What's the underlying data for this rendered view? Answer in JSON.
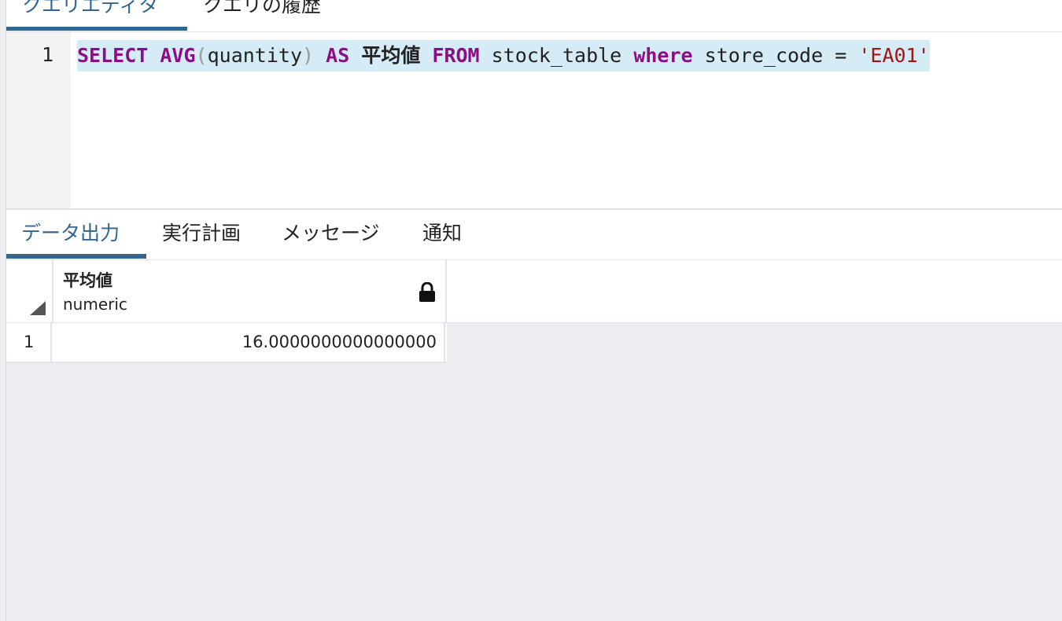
{
  "top_tabs": [
    {
      "label": "クエリエディタ",
      "active": true
    },
    {
      "label": "クエリの履歴",
      "active": false
    }
  ],
  "editor": {
    "line_number": "1",
    "sql": {
      "select": "SELECT",
      "func": "AVG",
      "open_paren": "(",
      "column": "quantity",
      "close_paren": ")",
      "as": "AS",
      "alias": "平均値",
      "from": "FROM",
      "table": "stock_table",
      "where": "where",
      "condition_column": "store_code",
      "equals": "=",
      "value": "'EA01'"
    }
  },
  "result_tabs": [
    {
      "label": "データ出力",
      "active": true
    },
    {
      "label": "実行計画",
      "active": false
    },
    {
      "label": "メッセージ",
      "active": false
    },
    {
      "label": "通知",
      "active": false
    }
  ],
  "grid": {
    "columns": [
      {
        "name": "平均値",
        "type": "numeric",
        "icon": "lock-icon"
      }
    ],
    "rows": [
      {
        "num": "1",
        "values": [
          "16.0000000000000000"
        ]
      }
    ]
  },
  "colors": {
    "accent": "#326690",
    "keyword": "#8b0d87",
    "string": "#a31515",
    "line_highlight": "#d5ebf6",
    "empty_grid": "#ebedf1"
  }
}
